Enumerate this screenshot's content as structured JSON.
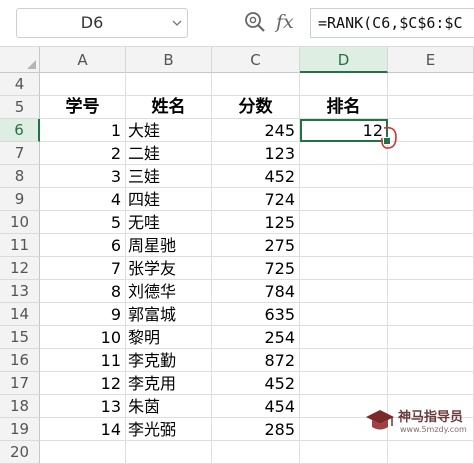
{
  "formula_bar": {
    "cell_ref": "D6",
    "fx_label": "fx",
    "formula": "=RANK(C6,$C$6:$C"
  },
  "columns": [
    "A",
    "B",
    "C",
    "D",
    "E"
  ],
  "active_column": "D",
  "active_row": "6",
  "rows": [
    {
      "num": "4",
      "a": "",
      "b": "",
      "c": "",
      "d": "",
      "header": false
    },
    {
      "num": "5",
      "a": "学号",
      "b": "姓名",
      "c": "分数",
      "d": "排名",
      "header": true
    },
    {
      "num": "6",
      "a": "1",
      "b": "大娃",
      "c": "245",
      "d": "12",
      "header": false
    },
    {
      "num": "7",
      "a": "2",
      "b": "二娃",
      "c": "123",
      "d": "",
      "header": false
    },
    {
      "num": "8",
      "a": "3",
      "b": "三娃",
      "c": "452",
      "d": "",
      "header": false
    },
    {
      "num": "9",
      "a": "4",
      "b": "四娃",
      "c": "724",
      "d": "",
      "header": false
    },
    {
      "num": "10",
      "a": "5",
      "b": "无哇",
      "c": "125",
      "d": "",
      "header": false
    },
    {
      "num": "11",
      "a": "6",
      "b": "周星驰",
      "c": "275",
      "d": "",
      "header": false
    },
    {
      "num": "12",
      "a": "7",
      "b": "张学友",
      "c": "725",
      "d": "",
      "header": false
    },
    {
      "num": "13",
      "a": "8",
      "b": "刘德华",
      "c": "784",
      "d": "",
      "header": false
    },
    {
      "num": "14",
      "a": "9",
      "b": "郭富城",
      "c": "635",
      "d": "",
      "header": false
    },
    {
      "num": "15",
      "a": "10",
      "b": "黎明",
      "c": "254",
      "d": "",
      "header": false
    },
    {
      "num": "16",
      "a": "11",
      "b": "李克勤",
      "c": "872",
      "d": "",
      "header": false
    },
    {
      "num": "17",
      "a": "12",
      "b": "李克用",
      "c": "452",
      "d": "",
      "header": false
    },
    {
      "num": "18",
      "a": "13",
      "b": "朱茵",
      "c": "454",
      "d": "",
      "header": false
    },
    {
      "num": "19",
      "a": "14",
      "b": "李光弼",
      "c": "285",
      "d": "",
      "header": false
    },
    {
      "num": "20",
      "a": "",
      "b": "",
      "c": "",
      "d": "",
      "header": false
    }
  ],
  "watermark": {
    "text": "神马指导员",
    "sub": "www.5mzdy.com"
  },
  "colors": {
    "accent": "#217346",
    "header_bg": "#f3f3f3",
    "red_mark": "#d9302c"
  }
}
